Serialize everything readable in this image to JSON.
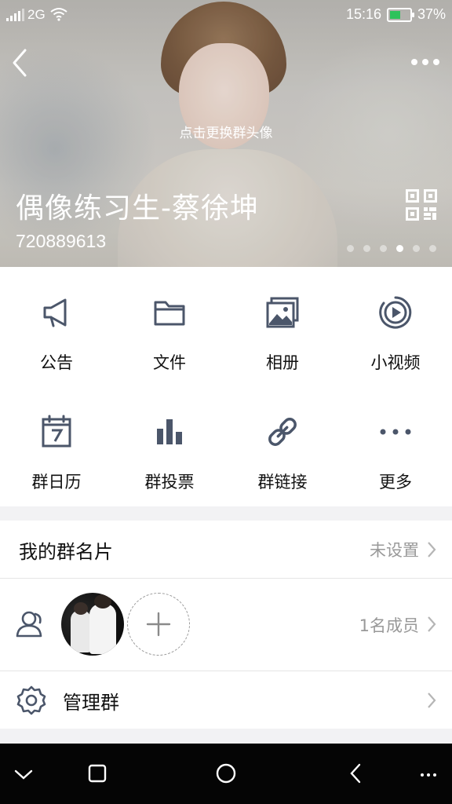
{
  "status_bar": {
    "network": "2G",
    "time": "15:16",
    "battery_percent": "37%",
    "battery_level": 0.37,
    "battery_color": "#2ec25b"
  },
  "header": {
    "change_avatar_hint": "点击更换群头像",
    "group_name": "偶像练习生-蔡徐坤",
    "group_id": "720889613",
    "page_indicator": {
      "count": 6,
      "active": 3
    }
  },
  "features": [
    {
      "label": "公告",
      "icon": "megaphone-icon"
    },
    {
      "label": "文件",
      "icon": "folder-icon"
    },
    {
      "label": "相册",
      "icon": "album-icon"
    },
    {
      "label": "小视频",
      "icon": "video-icon"
    },
    {
      "label": "群日历",
      "icon": "calendar-icon"
    },
    {
      "label": "群投票",
      "icon": "poll-icon"
    },
    {
      "label": "群链接",
      "icon": "link-icon"
    },
    {
      "label": "更多",
      "icon": "more-icon"
    }
  ],
  "my_card": {
    "label": "我的群名片",
    "value": "未设置"
  },
  "members": {
    "count_text": "1名成员"
  },
  "manage": {
    "label": "管理群"
  },
  "colors": {
    "icon": "#4b566a",
    "accent_text": "#999999"
  }
}
